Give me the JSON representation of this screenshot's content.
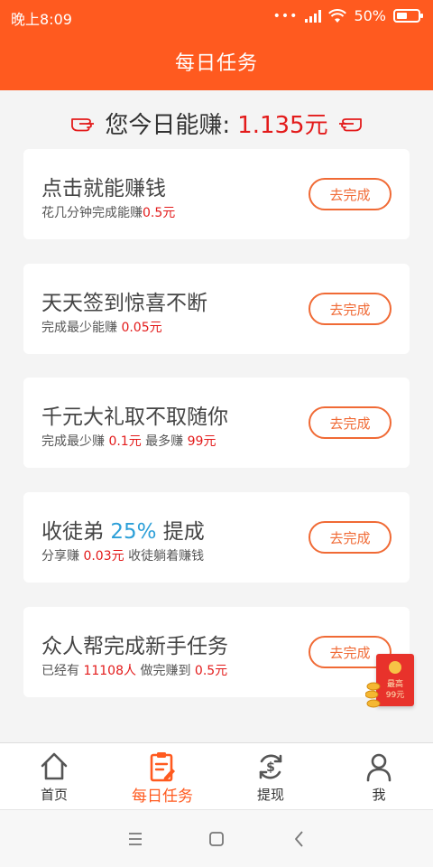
{
  "status_bar": {
    "time": "晚上8:09",
    "dots": "•••",
    "battery_percent": "50%"
  },
  "header": {
    "title": "每日任务"
  },
  "summary": {
    "prefix": "您今日能赚:",
    "amount": "1.135元"
  },
  "tasks": [
    {
      "title": "点击就能赚钱",
      "sub_parts": [
        {
          "text": "花几分钟完成能赚",
          "red": false
        },
        {
          "text": "0.5元",
          "red": true
        }
      ],
      "button": "去完成"
    },
    {
      "title": "天天签到惊喜不断",
      "sub_parts": [
        {
          "text": "完成最少能赚 ",
          "red": false
        },
        {
          "text": "0.05元",
          "red": true
        }
      ],
      "button": "去完成"
    },
    {
      "title": "千元大礼取不取随你",
      "sub_parts": [
        {
          "text": "完成最少赚 ",
          "red": false
        },
        {
          "text": "0.1元",
          "red": true
        },
        {
          "text": " 最多赚 ",
          "red": false
        },
        {
          "text": "99元",
          "red": true
        }
      ],
      "button": "去完成"
    },
    {
      "title_prefix": "收徒弟 ",
      "title_highlight": "25%",
      "title_suffix": " 提成",
      "sub_parts": [
        {
          "text": "分享赚 ",
          "red": false
        },
        {
          "text": "0.03元",
          "red": true
        },
        {
          "text": " 收徒躺着赚钱",
          "red": false
        }
      ],
      "button": "去完成"
    },
    {
      "title": "众人帮完成新手任务",
      "sub_parts": [
        {
          "text": "已经有 ",
          "red": false
        },
        {
          "text": "11108人",
          "red": true
        },
        {
          "text": " 做完赚到 ",
          "red": false
        },
        {
          "text": "0.5元",
          "red": true
        }
      ],
      "button": "去完成"
    }
  ],
  "red_packet": {
    "line1": "最高",
    "line2": "99元"
  },
  "tabs": [
    {
      "label": "首页",
      "icon": "home-icon",
      "active": false
    },
    {
      "label": "每日任务",
      "icon": "task-clipboard-icon",
      "active": true
    },
    {
      "label": "提现",
      "icon": "withdraw-money-icon",
      "active": false
    },
    {
      "label": "我",
      "icon": "user-icon",
      "active": false
    }
  ],
  "colors": {
    "brand": "#ff5a1f",
    "money_red": "#e31b1b",
    "highlight_blue": "#2c9fd8",
    "button_border": "#f06a35"
  }
}
